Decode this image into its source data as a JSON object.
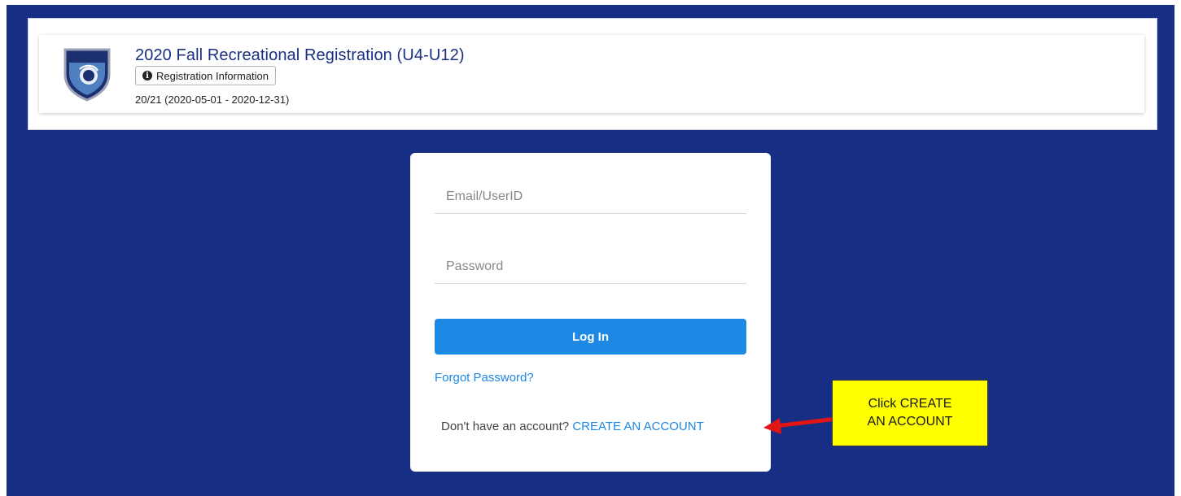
{
  "header": {
    "title": "2020 Fall Recreational Registration (U4-U12)",
    "info_button_label": "Registration Information",
    "season": "20/21 (2020-05-01 - 2020-12-31)",
    "logo_icon": "club-crest-icon"
  },
  "login": {
    "email_placeholder": "Email/UserID",
    "password_placeholder": "Password",
    "login_label": "Log In",
    "forgot_label": "Forgot Password?",
    "no_account_text": "Don't have an account?",
    "create_account_label": "CREATE AN ACCOUNT"
  },
  "annotation": {
    "callout_text": "Click CREATE AN ACCOUNT",
    "arrow_color": "#e01515"
  },
  "colors": {
    "background": "#162f85",
    "accent": "#1e88e5",
    "title": "#1b2f82",
    "callout": "#ffff00"
  }
}
